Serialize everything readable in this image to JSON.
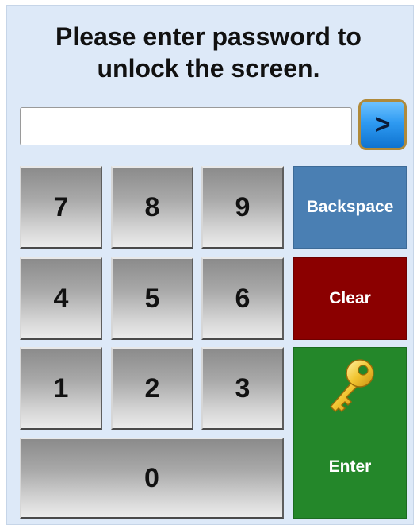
{
  "title": "Please enter password to\nunlock the screen.",
  "password": {
    "value": "",
    "placeholder": ""
  },
  "go_button": {
    "label": ">"
  },
  "keypad": {
    "k7": "7",
    "k8": "8",
    "k9": "9",
    "k4": "4",
    "k5": "5",
    "k6": "6",
    "k1": "1",
    "k2": "2",
    "k3": "3",
    "k0": "0"
  },
  "actions": {
    "backspace": "Backspace",
    "clear": "Clear",
    "enter": "Enter"
  },
  "colors": {
    "panel": "#dde9f8",
    "backspace": "#4a7fb3",
    "clear": "#8b0000",
    "enter": "#24872a",
    "go": "#2f9bf2"
  },
  "icons": {
    "enter_icon": "key-icon"
  }
}
